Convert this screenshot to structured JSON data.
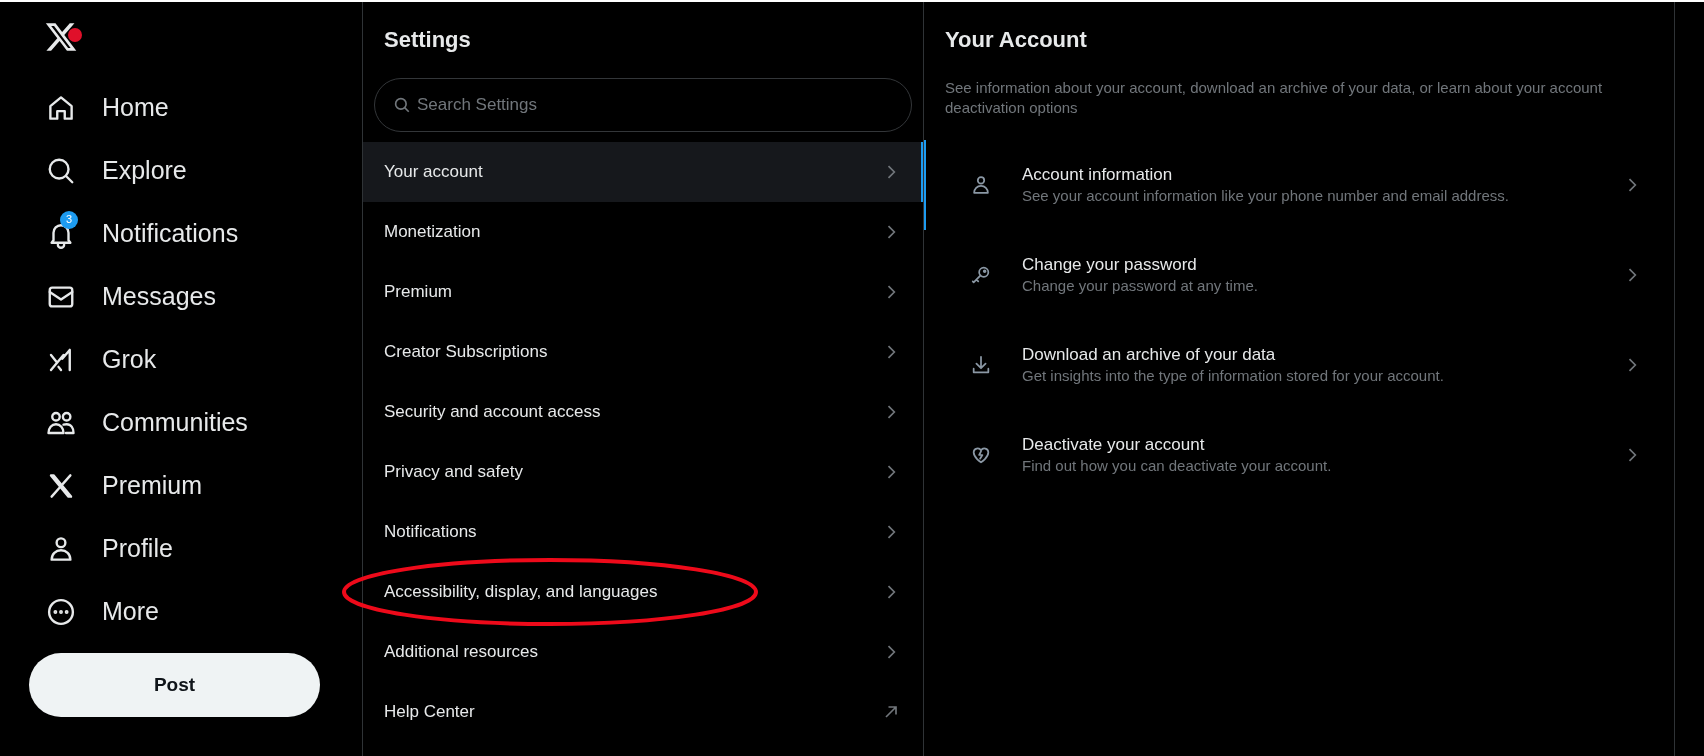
{
  "nav": {
    "logo": {
      "badge": true
    },
    "items": [
      {
        "kind": "home",
        "label": "Home",
        "selected": false
      },
      {
        "kind": "search",
        "label": "Explore",
        "selected": false
      },
      {
        "kind": "bell",
        "label": "Notifications",
        "selected": false,
        "badge": "3"
      },
      {
        "kind": "mail",
        "label": "Messages",
        "selected": false
      },
      {
        "kind": "grok",
        "label": "Grok",
        "selected": false
      },
      {
        "kind": "people",
        "label": "Communities",
        "selected": false
      },
      {
        "kind": "x",
        "label": "Premium",
        "selected": false
      },
      {
        "kind": "person",
        "label": "Profile",
        "selected": false
      },
      {
        "kind": "more",
        "label": "More",
        "selected": false
      }
    ],
    "post_button": "Post"
  },
  "settings": {
    "title": "Settings",
    "search": {
      "placeholder": "Search Settings"
    },
    "items": [
      {
        "label": "Your account",
        "kind": "chevron",
        "selected": true,
        "highlighted": false
      },
      {
        "label": "Monetization",
        "kind": "chevron",
        "selected": false,
        "highlighted": false
      },
      {
        "label": "Premium",
        "kind": "chevron",
        "selected": false,
        "highlighted": false
      },
      {
        "label": "Creator Subscriptions",
        "kind": "chevron",
        "selected": false,
        "highlighted": false
      },
      {
        "label": "Security and account access",
        "kind": "chevron",
        "selected": false,
        "highlighted": false
      },
      {
        "label": "Privacy and safety",
        "kind": "chevron",
        "selected": false,
        "highlighted": false
      },
      {
        "label": "Notifications",
        "kind": "chevron",
        "selected": false,
        "highlighted": false
      },
      {
        "label": "Accessibility, display, and languages",
        "kind": "chevron",
        "selected": false,
        "highlighted": true
      },
      {
        "label": "Additional resources",
        "kind": "chevron",
        "selected": false,
        "highlighted": false
      },
      {
        "label": "Help Center",
        "kind": "external",
        "selected": false,
        "highlighted": false
      }
    ]
  },
  "detail": {
    "title": "Your Account",
    "description": "See information about your account, download an archive of your data, or learn about your account deactivation options",
    "items": [
      {
        "kind": "person",
        "title": "Account information",
        "subtitle": "See your account information like your phone number and email address.",
        "selected": true
      },
      {
        "kind": "key",
        "title": "Change your password",
        "subtitle": "Change your password at any time.",
        "selected": false
      },
      {
        "kind": "download",
        "title": "Download an archive of your data",
        "subtitle": "Get insights into the type of information stored for your account.",
        "selected": false
      },
      {
        "kind": "heart",
        "title": "Deactivate your account",
        "subtitle": "Find out how you can deactivate your account.",
        "selected": false
      }
    ]
  }
}
